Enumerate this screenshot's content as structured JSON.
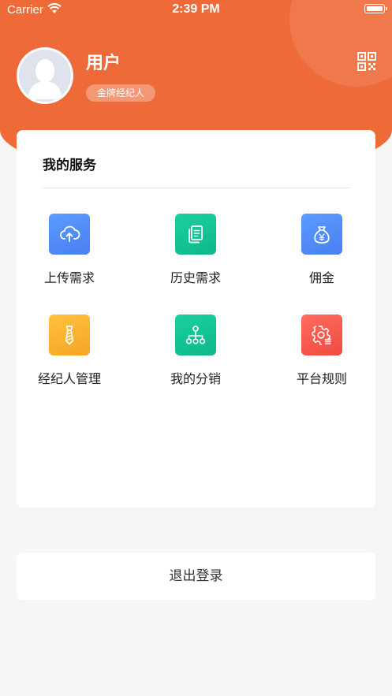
{
  "status_bar": {
    "carrier": "Carrier",
    "time": "2:39 PM"
  },
  "profile": {
    "name": "用户",
    "badge": "金牌经纪人"
  },
  "services": {
    "title": "我的服务",
    "items": [
      {
        "label": "上传需求",
        "icon": "cloud-upload-icon",
        "color": "#4f8ef7"
      },
      {
        "label": "历史需求",
        "icon": "documents-icon",
        "color": "#13c497"
      },
      {
        "label": "佣金",
        "icon": "money-bag-icon",
        "color": "#4f8ef7"
      },
      {
        "label": "经纪人管理",
        "icon": "tie-icon",
        "color": "#f7b131"
      },
      {
        "label": "我的分销",
        "icon": "network-icon",
        "color": "#13c497"
      },
      {
        "label": "平台规则",
        "icon": "settings-gear-icon",
        "color": "#f5574c"
      }
    ]
  },
  "logout_label": "退出登录",
  "colors": {
    "header": "#ee6a38",
    "background": "#f6f6f6"
  }
}
